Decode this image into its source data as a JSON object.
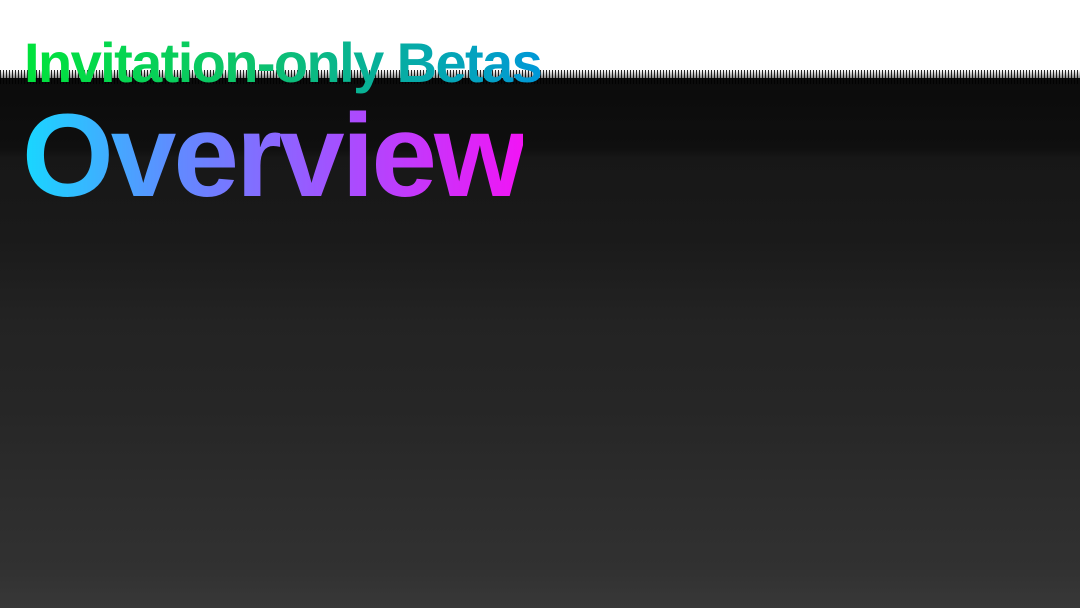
{
  "slide": {
    "kicker": "Invitation-only Betas",
    "title": "Overview"
  },
  "colors": {
    "kicker_gradient": [
      "#00e33b",
      "#0dc26d",
      "#0098d8"
    ],
    "title_gradient": [
      "#17d8ff",
      "#5f8cff",
      "#a252ff",
      "#f214f5"
    ],
    "background_dark": "#0b0b0b",
    "background_light": "#383838",
    "background_top": "#ffffff"
  }
}
